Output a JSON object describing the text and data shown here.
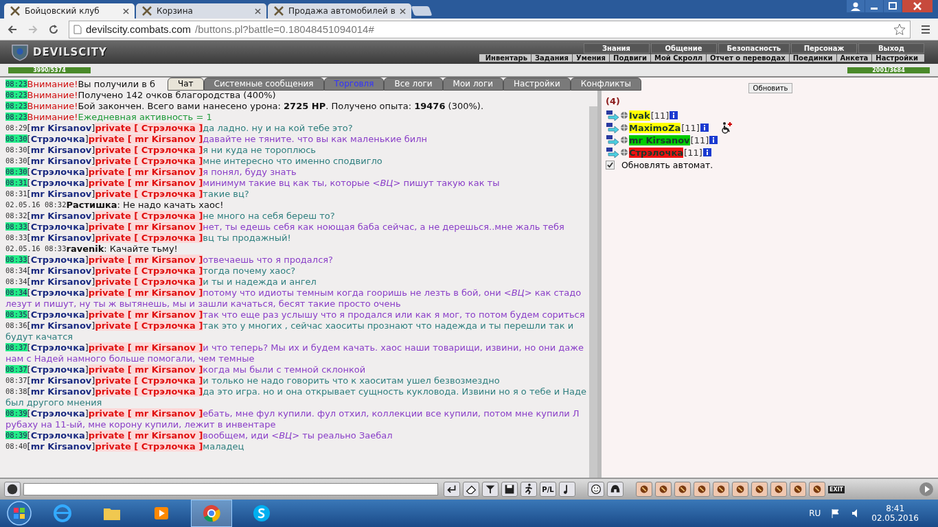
{
  "browser": {
    "tabs": [
      {
        "title": "Бойцовский клуб",
        "selected": true
      },
      {
        "title": "Корзина",
        "selected": false
      },
      {
        "title": "Продажа автомобилей в",
        "selected": false
      }
    ],
    "address": {
      "host": "devilscity.combats.com",
      "path": "/buttons.pl?battle=0.18048451094014#"
    }
  },
  "game": {
    "logo": "DEVILSCITY",
    "top_menu": [
      "Знания",
      "Общение",
      "Безопасность",
      "Персонаж",
      "Выход"
    ],
    "sub_menu": [
      "Инвентарь",
      "Задания",
      "Умения",
      "Подвиги",
      "Мой Скролл",
      "Отчет о переводах",
      "Поединки",
      "Анкета",
      "Настройки"
    ],
    "battle": {
      "left_hp": "3990/5374",
      "right_hp": "2001/3684"
    }
  },
  "chat_tabs": [
    {
      "label": "Чат",
      "selected": true,
      "kind": "tab"
    },
    {
      "label": "Системные сообщения",
      "selected": false,
      "kind": "tab"
    },
    {
      "label": "Торговля",
      "selected": false,
      "kind": "link"
    },
    {
      "label": "Все логи",
      "selected": false,
      "kind": "tab"
    },
    {
      "label": "Мои логи",
      "selected": false,
      "kind": "tab"
    },
    {
      "label": "Настройки",
      "selected": false,
      "kind": "tab"
    },
    {
      "label": "Конфликты",
      "selected": false,
      "kind": "tab"
    }
  ],
  "messages": [
    {
      "kind": "notice",
      "time": "08:23",
      "highlight": true,
      "label": "Внимание!",
      "text": "Вы получили в б"
    },
    {
      "kind": "notice",
      "time": "08:23",
      "highlight": true,
      "label": "Внимание!",
      "text": "Получено 142 очков благородства (400%)"
    },
    {
      "kind": "notice",
      "time": "08:23",
      "highlight": true,
      "label": "Внимание!",
      "text": "Бой закончен. Всего вами нанесено урона: **2725 HP**. Получено опыта: **19476** (300%)."
    },
    {
      "kind": "activity",
      "time": "08:23",
      "highlight": true,
      "label": "Внимание!",
      "text": "Ежедневная активность = 1"
    },
    {
      "kind": "private",
      "time": "08:29",
      "highlight": false,
      "from": "[**mr Kirsanov**]",
      "to": "private [ Стрэлочка ]",
      "text": "да ладно. ну и на кой тебе это?",
      "color": "#2f7f7f"
    },
    {
      "kind": "private",
      "time": "08:30",
      "highlight": true,
      "from": "[**Стрэлочка**]",
      "to": "private [ mr Kirsanov ]",
      "text": "давайте не тяните. что вы как маленькие билн",
      "color": "#8a3fc8"
    },
    {
      "kind": "private",
      "time": "08:30",
      "highlight": false,
      "from": "[**mr Kirsanov**]",
      "to": "private [ Стрэлочка ]",
      "text": "я ни куда не тороплюсь",
      "color": "#2f7f7f"
    },
    {
      "kind": "private",
      "time": "08:30",
      "highlight": false,
      "from": "[**mr Kirsanov**]",
      "to": "private [ Стрэлочка ]",
      "text": "мне интересно что именно сподвигло",
      "color": "#2f7f7f"
    },
    {
      "kind": "private",
      "time": "08:30",
      "highlight": true,
      "from": "[**Стрэлочка**]",
      "to": "private [ mr Kirsanov ]",
      "text": "я понял, буду знать",
      "color": "#8a3fc8"
    },
    {
      "kind": "private",
      "time": "08:31",
      "highlight": true,
      "from": "[**Стрэлочка**]",
      "to": "private [ mr Kirsanov ]",
      "text": "минимум такие вц как ты, которые *<ВЦ>* пишут такую как ты",
      "color": "#8a3fc8"
    },
    {
      "kind": "private",
      "time": "08:31",
      "highlight": false,
      "from": "[**mr Kirsanov**]",
      "to": "private [ Стрэлочка ]",
      "text": "такие вц?",
      "color": "#2f7f7f"
    },
    {
      "kind": "public",
      "time": "02.05.16 08:32",
      "highlight": false,
      "from": "Растишка",
      "text": ": Не надо качать хаос!"
    },
    {
      "kind": "private",
      "time": "08:32",
      "highlight": false,
      "from": "[**mr Kirsanov**]",
      "to": "private [ Стрэлочка ]",
      "text": "не много на себя береш то?",
      "color": "#2f7f7f"
    },
    {
      "kind": "private",
      "time": "08:33",
      "highlight": true,
      "from": "[**Стрэлочка**]",
      "to": "private [ mr Kirsanov ]",
      "text": "нет, ты едешь себя как ноющая баба сейчас, а не дерешься..мне жаль тебя",
      "color": "#8a3fc8"
    },
    {
      "kind": "private",
      "time": "08:33",
      "highlight": false,
      "from": "[**mr Kirsanov**]",
      "to": "private [ Стрэлочка ]",
      "text": "вц ты продажный!",
      "color": "#2f7f7f"
    },
    {
      "kind": "public",
      "time": "02.05.16 08:33",
      "highlight": false,
      "from": "ravenik",
      "text": ": Качайте тьму!"
    },
    {
      "kind": "private",
      "time": "08:33",
      "highlight": true,
      "from": "[**Стрэлочка**]",
      "to": "private [ mr Kirsanov ]",
      "text": "отвечаешь что я продался?",
      "color": "#8a3fc8"
    },
    {
      "kind": "private",
      "time": "08:34",
      "highlight": false,
      "from": "[**mr Kirsanov**]",
      "to": "private [ Стрэлочка ]",
      "text": "тогда почему хаос?",
      "color": "#2f7f7f"
    },
    {
      "kind": "private",
      "time": "08:34",
      "highlight": false,
      "from": "[**mr Kirsanov**]",
      "to": "private [ Стрэлочка ]",
      "text": "и ты и надежда и ангел",
      "color": "#2f7f7f"
    },
    {
      "kind": "private",
      "time": "08:34",
      "highlight": true,
      "from": "[**Стрэлочка**]",
      "to": "private [ mr Kirsanov ]",
      "text": "потому что идиоты темным когда гооришь не лезть в бой, они *<ВЦ>* как стадо лезут и пишут, ну ты ж вытянешь, мы и зашли качаться, бесят такие просто очень",
      "color": "#8a3fc8"
    },
    {
      "kind": "private",
      "time": "08:35",
      "highlight": true,
      "from": "[**Стрэлочка**]",
      "to": "private [ mr Kirsanov ]",
      "text": "так что еще раз услышу что я продался или как я мог, то потом будем сориться",
      "color": "#8a3fc8"
    },
    {
      "kind": "private",
      "time": "08:36",
      "highlight": false,
      "from": "[**mr Kirsanov**]",
      "to": "private [ Стрэлочка ]",
      "text": "так это у многих , сейчас хаоситы прознают что надежда и ты перешли так и будут качатся",
      "color": "#2f7f7f"
    },
    {
      "kind": "private",
      "time": "08:37",
      "highlight": true,
      "from": "[**Стрэлочка**]",
      "to": "private [ mr Kirsanov ]",
      "text": "и что теперь? Мы их и будем качать. хаос наши товарищи, извини, но они даже нам с Надей намного больше помогали, чем темные",
      "color": "#8a3fc8"
    },
    {
      "kind": "private",
      "time": "08:37",
      "highlight": true,
      "from": "[**Стрэлочка**]",
      "to": "private [ mr Kirsanov ]",
      "text": "когда мы были с темной склонкой",
      "color": "#8a3fc8"
    },
    {
      "kind": "private",
      "time": "08:37",
      "highlight": false,
      "from": "[**mr Kirsanov**]",
      "to": "private [ Стрэлочка ]",
      "text": "и только не надо говорить что к хаоситам ушел безвозмездно",
      "color": "#2f7f7f"
    },
    {
      "kind": "private",
      "time": "08:38",
      "highlight": false,
      "from": "[**mr Kirsanov**]",
      "to": "private [ Стрэлочка ]",
      "text": "да это игра. но и она открывает сущность кукловода. Извини но я о тебе и Наде был другого мнения",
      "color": "#2f7f7f"
    },
    {
      "kind": "private",
      "time": "08:39",
      "highlight": true,
      "from": "[**Стрэлочка**]",
      "to": "private [ mr Kirsanov ]",
      "text": "ебать, мне фул купили. фул отхил, коллекции все купили, потом мне купили Л рубаху на 11-ый, мне корону купили, лежит в инвентаре",
      "color": "#8a3fc8"
    },
    {
      "kind": "private",
      "time": "08:39",
      "highlight": true,
      "from": "[**Стрэлочка**]",
      "to": "private [ mr Kirsanov ]",
      "text": "вообщем, иди *<ВЦ>* ты реально Заебал",
      "color": "#8a3fc8"
    },
    {
      "kind": "private",
      "time": "08:40",
      "highlight": false,
      "from": "[**mr Kirsanov**]",
      "to": "private [ Стрэлочка ]",
      "text": "маладец",
      "color": "#2f7f7f"
    }
  ],
  "side": {
    "refresh_button": "Обновить",
    "count": "(4)",
    "players": [
      {
        "name": "Ivak",
        "level": "[11]",
        "color": "#ffff00",
        "injured": false
      },
      {
        "name": "MaximoZa",
        "level": "[11]",
        "color": "#ffff00",
        "injured": true
      },
      {
        "name": "mr Kirsanov",
        "level": "[11]",
        "color": "#00cc00",
        "injured": false
      },
      {
        "name": "Стрэлочка",
        "level": "[11]",
        "color": "#ee1111",
        "injured": false
      }
    ],
    "auto_refresh": {
      "label": "Обновлять автомат.",
      "checked": true
    }
  },
  "toolbar": {
    "pl_label": "P/L",
    "exit_label": "EXIT"
  },
  "taskbar": {
    "language": "RU",
    "time": "8:41",
    "date": "02.05.2016"
  }
}
